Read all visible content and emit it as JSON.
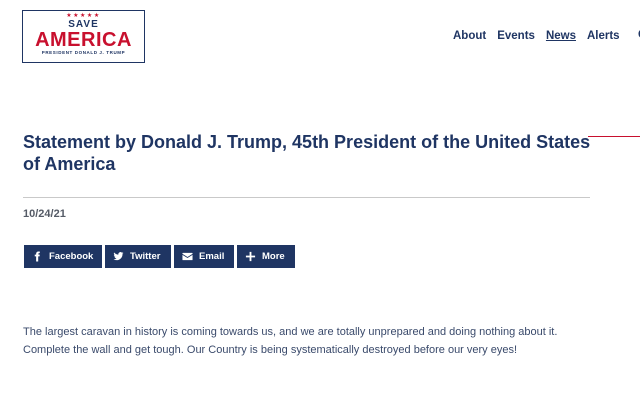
{
  "logo": {
    "stars": "★★★★★",
    "line1": "SAVE",
    "line2": "AMERICA",
    "line3": "PRESIDENT DONALD J. TRUMP"
  },
  "nav": {
    "items": [
      {
        "label": "About"
      },
      {
        "label": "Events"
      },
      {
        "label": "News",
        "active": true
      },
      {
        "label": "Alerts"
      }
    ],
    "overflow": "C"
  },
  "article": {
    "title": "Statement by Donald J. Trump, 45th President of the United States of America",
    "date": "10/24/21",
    "body": "The largest caravan in history is coming towards us, and we are totally unprepared and doing nothing about it. Complete the wall and get tough. Our Country is being systematically destroyed before our very eyes!"
  },
  "share": {
    "facebook": "Facebook",
    "twitter": "Twitter",
    "email": "Email",
    "more": "More"
  },
  "colors": {
    "navy": "#1f3563",
    "red": "#c8102e"
  }
}
